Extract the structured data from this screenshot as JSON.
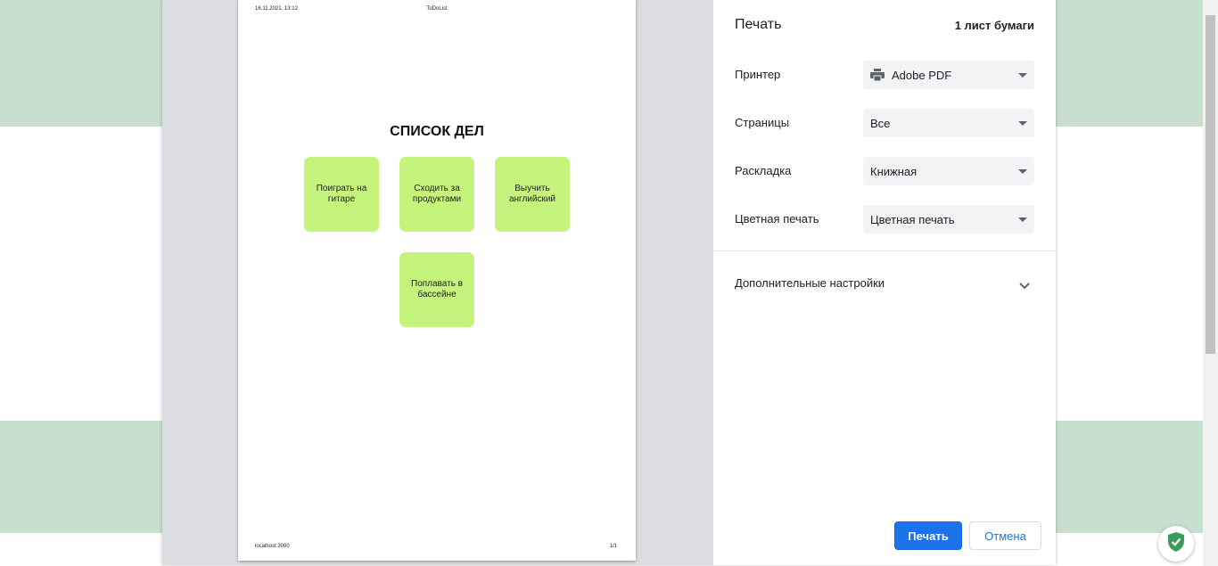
{
  "preview": {
    "header_date": "16.11.2021, 13:12",
    "header_title": "ToDoList",
    "footer_url": "localhost:3000",
    "footer_pages": "1/1",
    "list_title": "СПИСОК ДЕЛ",
    "cards": [
      "Поиграть на гитаре",
      "Сходить за продуктами",
      "Выучить английский",
      "Поплавать в бассейне"
    ],
    "card_color": "#c4f47c"
  },
  "panel": {
    "title": "Печать",
    "sheet_count": "1 лист бумаги",
    "printer": {
      "label": "Принтер",
      "value": "Adobe PDF",
      "icon": "printer-icon"
    },
    "pages": {
      "label": "Страницы",
      "value": "Все"
    },
    "layout": {
      "label": "Раскладка",
      "value": "Книжная"
    },
    "color": {
      "label": "Цветная печать",
      "value": "Цветная печать"
    },
    "more_settings": "Дополнительные настройки",
    "print_button": "Печать",
    "cancel_button": "Отмена"
  },
  "colors": {
    "accent": "#1a73e8",
    "background_band": "#c8dfd0",
    "shield": "#3c9b5a"
  }
}
